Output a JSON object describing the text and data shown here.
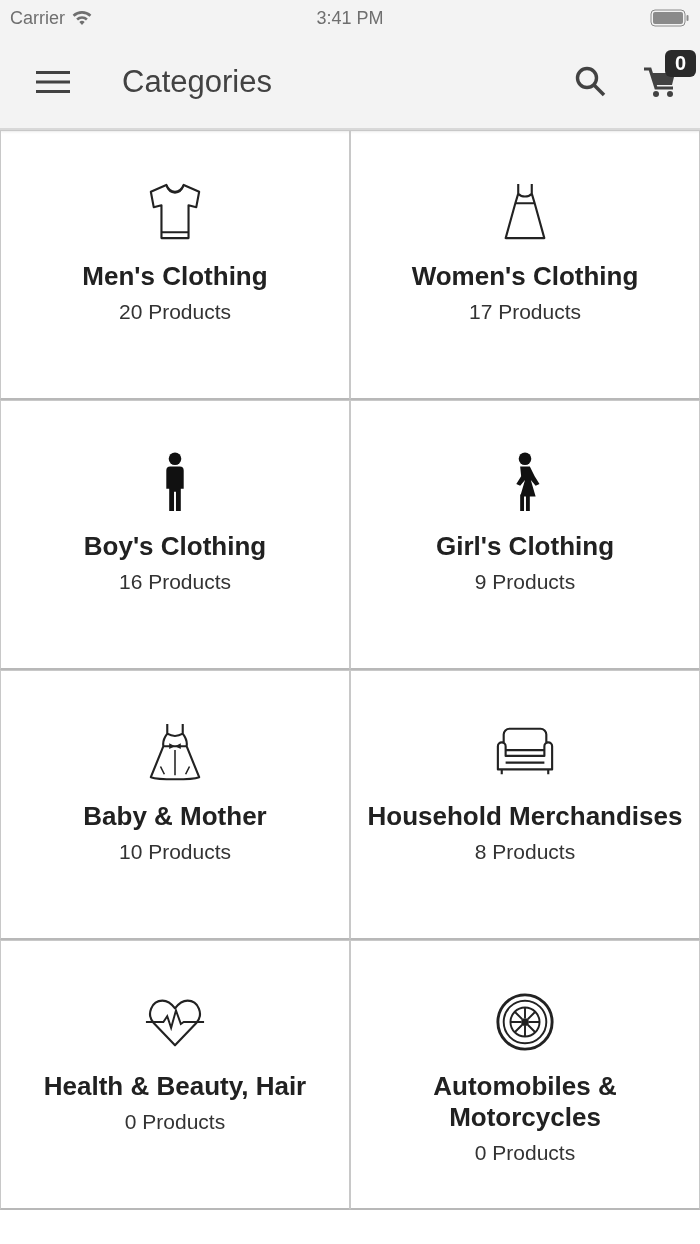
{
  "status_bar": {
    "carrier": "Carrier",
    "time": "3:41 PM"
  },
  "header": {
    "title": "Categories",
    "cart_count": "0"
  },
  "categories": [
    {
      "name": "Men's Clothing",
      "count": "20 Products"
    },
    {
      "name": "Women's Clothing",
      "count": "17 Products"
    },
    {
      "name": "Boy's Clothing",
      "count": "16 Products"
    },
    {
      "name": "Girl's Clothing",
      "count": "9 Products"
    },
    {
      "name": "Baby & Mother",
      "count": "10 Products"
    },
    {
      "name": "Household Merchandises",
      "count": "8 Products"
    },
    {
      "name": "Health & Beauty, Hair",
      "count": "0 Products"
    },
    {
      "name": "Automobiles & Motorcycles",
      "count": "0 Products"
    }
  ]
}
